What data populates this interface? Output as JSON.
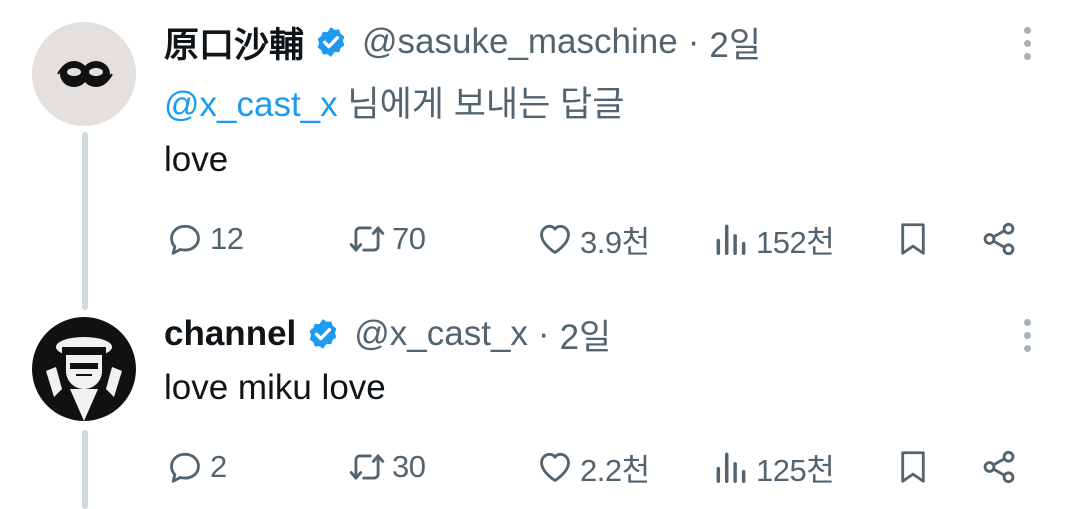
{
  "tweets": [
    {
      "name": "原口沙輔",
      "handle": "@sasuke_maschine",
      "separator": "·",
      "time": "2일",
      "reply_mention": "@x_cast_x",
      "reply_suffix": " 님에게 보내는 답글",
      "text": "love",
      "stats": {
        "replies": "12",
        "reposts": "70",
        "likes": "3.9천",
        "views": "152천"
      }
    },
    {
      "name": "channel",
      "handle": "@x_cast_x",
      "separator": "·",
      "time": "2일",
      "text": "love miku love",
      "stats": {
        "replies": "2",
        "reposts": "30",
        "likes": "2.2천",
        "views": "125천"
      }
    }
  ],
  "icons": {
    "reply": "speech-bubble-icon",
    "repost": "repost-arrows-icon",
    "like": "heart-icon",
    "views": "bar-chart-icon",
    "bookmark": "bookmark-icon",
    "share": "share-icon",
    "verified": "verified-badge-icon",
    "more": "more-vertical-icon"
  },
  "colors": {
    "accent": "#1d9bf0",
    "muted": "#536471",
    "text": "#0f1419",
    "thread_line": "#cfd9de"
  }
}
